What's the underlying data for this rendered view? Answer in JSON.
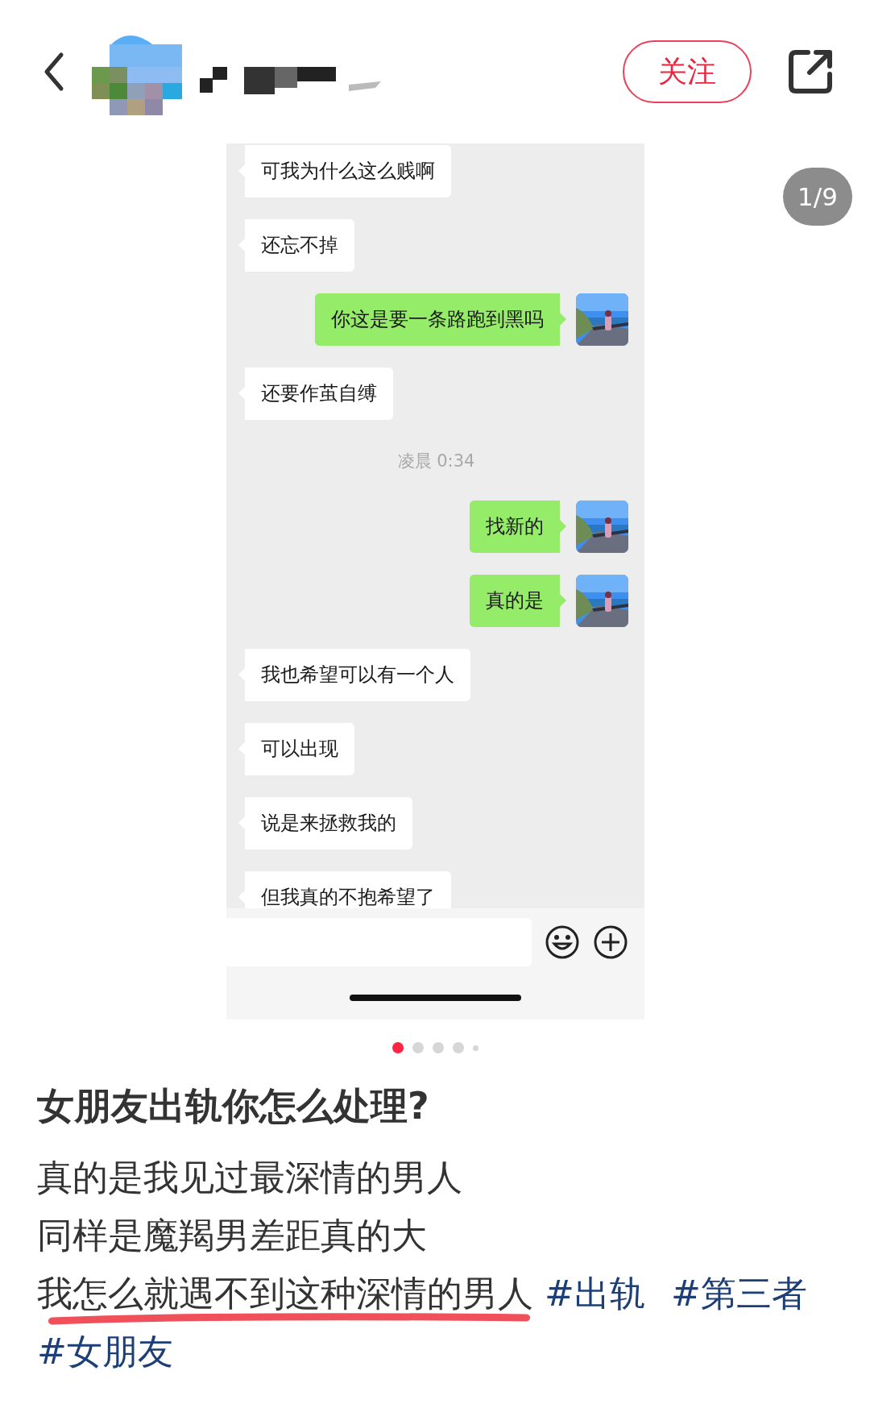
{
  "header": {
    "follow_button": "关注"
  },
  "carousel": {
    "page_counter": "1/9",
    "messages": [
      {
        "kind": "received",
        "text": "可我为什么这么贱啊"
      },
      {
        "kind": "received",
        "text": "还忘不掉"
      },
      {
        "kind": "sent",
        "text": "你这是要一条路跑到黑吗"
      },
      {
        "kind": "received",
        "text": "还要作茧自缚"
      },
      {
        "kind": "time",
        "text": "凌晨 0:34"
      },
      {
        "kind": "sent",
        "text": "找新的"
      },
      {
        "kind": "sent",
        "text": "真的是"
      },
      {
        "kind": "received",
        "text": "我也希望可以有一个人"
      },
      {
        "kind": "received",
        "text": "可以出现"
      },
      {
        "kind": "received",
        "text": "说是来拯救我的"
      },
      {
        "kind": "received",
        "text": "但我真的不抱希望了"
      }
    ],
    "dots": [
      {
        "kind": "dot",
        "selected": true
      },
      {
        "kind": "dot",
        "selected": false
      },
      {
        "kind": "dot",
        "selected": false
      },
      {
        "kind": "dot",
        "selected": false
      },
      {
        "kind": "more",
        "selected": false
      }
    ]
  },
  "post": {
    "title": "女朋友出轨你怎么处理?",
    "lines": [
      {
        "text": "真的是我见过最深情的男人",
        "underlined": false
      },
      {
        "text": "同样是魔羯男差距真的大",
        "underlined": false
      },
      {
        "text": "我怎么就遇不到这种深情的男人",
        "underlined": true
      }
    ],
    "tags": [
      "#出轨",
      "#第三者",
      "#女朋友"
    ]
  }
}
